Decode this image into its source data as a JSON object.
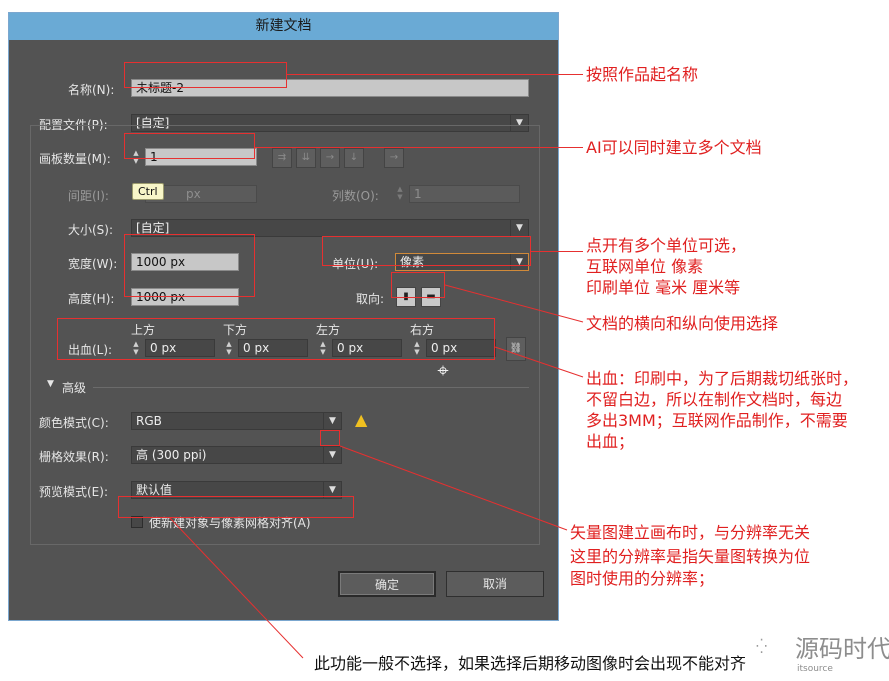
{
  "dialog": {
    "title": "新建文档",
    "name_label": "名称(N):",
    "name_value": "未标题-2",
    "profile_label": "配置文件(P):",
    "profile_value": "[自定]",
    "artboards_label": "画板数量(M):",
    "artboards_value": "1",
    "tooltip": "Ctrl",
    "spacing_label": "间距(I):",
    "spacing_unit": "px",
    "columns_label": "列数(O):",
    "columns_value": "1",
    "size_label": "大小(S):",
    "size_value": "[自定]",
    "width_label": "宽度(W):",
    "width_value": "1000 px",
    "height_label": "高度(H):",
    "height_value": "1000 px",
    "units_label": "单位(U):",
    "units_value": "像素",
    "orientation_label": "取向:",
    "bleed_label": "出血(L):",
    "bleed_top_label": "上方",
    "bleed_bottom_label": "下方",
    "bleed_left_label": "左方",
    "bleed_right_label": "右方",
    "bleed_top": "0 px",
    "bleed_bottom": "0 px",
    "bleed_left": "0 px",
    "bleed_right": "0 px",
    "advanced_label": "高级",
    "color_mode_label": "颜色模式(C):",
    "color_mode_value": "RGB",
    "raster_label": "栅格效果(R):",
    "raster_value": "高 (300 ppi)",
    "preview_label": "预览模式(E):",
    "preview_value": "默认值",
    "align_pixel_label": "使新建对象与像素网格对齐(A)",
    "ok_label": "确定",
    "cancel_label": "取消"
  },
  "annotations": {
    "name": "按照作品起名称",
    "artboards": "AI可以同时建立多个文档",
    "units_1": "点开有多个单位可选，",
    "units_2": "互联网单位  像素",
    "units_3": "印刷单位     毫米  厘米等",
    "orientation": "文档的横向和纵向使用选择",
    "bleed_1": "出血：印刷中，为了后期裁切纸张时，",
    "bleed_2": "不留白边，所以在制作文档时，每边",
    "bleed_3": "多出3MM；互联网作品制作，不需要",
    "bleed_4": "出血；",
    "raster_1": "矢量图建立画布时，与分辨率无关",
    "raster_2": "这里的分辨率是指矢量图转换为位",
    "raster_3": "图时使用的分辨率；",
    "align": "此功能一般不选择，如果选择后期移动图像时会出现不能对齐",
    "watermark_main": "源码时代",
    "watermark_sub": "itsource"
  },
  "colors": {
    "annotation": "#e63030",
    "titlebar": "#6aaad5",
    "dialog_bg": "#535353",
    "warning": "#f0c020"
  }
}
